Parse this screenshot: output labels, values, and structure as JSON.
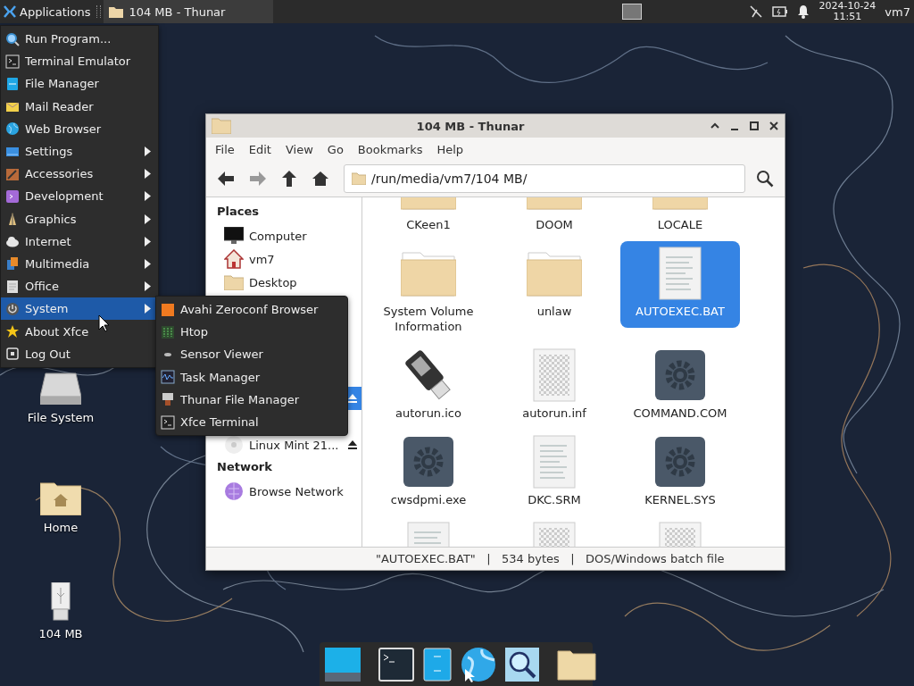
{
  "top_panel": {
    "applications_label": "Applications",
    "task": {
      "title": "104 MB - Thunar",
      "selected": true
    },
    "clock_date": "2024-10-24",
    "clock_time": "11:51",
    "user": "vm7"
  },
  "app_menu": [
    {
      "label": "Run Program...",
      "submenu": false,
      "selected": false
    },
    {
      "label": "Terminal Emulator",
      "submenu": false,
      "selected": false
    },
    {
      "label": "File Manager",
      "submenu": false,
      "selected": false
    },
    {
      "label": "Mail Reader",
      "submenu": false,
      "selected": false
    },
    {
      "label": "Web Browser",
      "submenu": false,
      "selected": false
    },
    {
      "label": "Settings",
      "submenu": true,
      "selected": false
    },
    {
      "label": "Accessories",
      "submenu": true,
      "selected": false
    },
    {
      "label": "Development",
      "submenu": true,
      "selected": false
    },
    {
      "label": "Graphics",
      "submenu": true,
      "selected": false
    },
    {
      "label": "Internet",
      "submenu": true,
      "selected": false
    },
    {
      "label": "Multimedia",
      "submenu": true,
      "selected": false
    },
    {
      "label": "Office",
      "submenu": true,
      "selected": false
    },
    {
      "label": "System",
      "submenu": true,
      "selected": true
    },
    {
      "label": "About Xfce",
      "submenu": false,
      "selected": false
    },
    {
      "label": "Log Out",
      "submenu": false,
      "selected": false
    }
  ],
  "system_submenu": [
    {
      "label": "Avahi Zeroconf Browser"
    },
    {
      "label": "Htop"
    },
    {
      "label": "Sensor Viewer"
    },
    {
      "label": "Task Manager"
    },
    {
      "label": "Thunar File Manager"
    },
    {
      "label": "Xfce Terminal"
    }
  ],
  "desktop_icons": [
    {
      "label": "File System",
      "kind": "drive"
    },
    {
      "label": "Home",
      "kind": "home"
    },
    {
      "label": "104 MB",
      "kind": "usb"
    }
  ],
  "window": {
    "title": "104 MB - Thunar",
    "menu": [
      "File",
      "Edit",
      "View",
      "Go",
      "Bookmarks",
      "Help"
    ],
    "toolbar": {
      "forward_disabled": true
    },
    "location": "/run/media/vm7/104 MB/",
    "sidebar": [
      {
        "heading": "Places",
        "items": [
          {
            "label": "Computer",
            "kind": "computer",
            "selected": false,
            "eject": false
          },
          {
            "label": "vm7",
            "kind": "home",
            "selected": false,
            "eject": false
          },
          {
            "label": "Desktop",
            "kind": "folder",
            "selected": false,
            "eject": false
          }
        ]
      },
      {
        "items": [
          {
            "selected": true,
            "eject": true
          },
          {
            "label": "Linux Mint 21...",
            "kind": "disc",
            "selected": false,
            "eject": true
          }
        ]
      },
      {
        "heading": "Network",
        "items": [
          {
            "label": "Browse Network",
            "kind": "network",
            "selected": false,
            "eject": false
          }
        ]
      }
    ],
    "files": [
      {
        "name": "CKeen1",
        "kind": "folder",
        "selected": false
      },
      {
        "name": "DOOM",
        "kind": "folder",
        "selected": false
      },
      {
        "name": "LOCALE",
        "kind": "folder",
        "selected": false
      },
      {
        "name": "System Volume Information",
        "kind": "folder",
        "selected": false
      },
      {
        "name": "unlaw",
        "kind": "folder",
        "selected": false
      },
      {
        "name": "AUTOEXEC.BAT",
        "kind": "text",
        "selected": true
      },
      {
        "name": "autorun.ico",
        "kind": "usb",
        "selected": false
      },
      {
        "name": "autorun.inf",
        "kind": "blank",
        "selected": false
      },
      {
        "name": "COMMAND.COM",
        "kind": "exec",
        "selected": false
      },
      {
        "name": "cwsdpmi.exe",
        "kind": "exec",
        "selected": false
      },
      {
        "name": "DKC.SRM",
        "kind": "text",
        "selected": false
      },
      {
        "name": "KERNEL.SYS",
        "kind": "exec",
        "selected": false
      },
      {
        "kind": "text",
        "selected": false
      },
      {
        "kind": "blank",
        "selected": false
      },
      {
        "kind": "blank",
        "selected": false
      }
    ],
    "status_bar": "\"AUTOEXEC.BAT\"   |   534 bytes   |   DOS/Windows batch file"
  }
}
